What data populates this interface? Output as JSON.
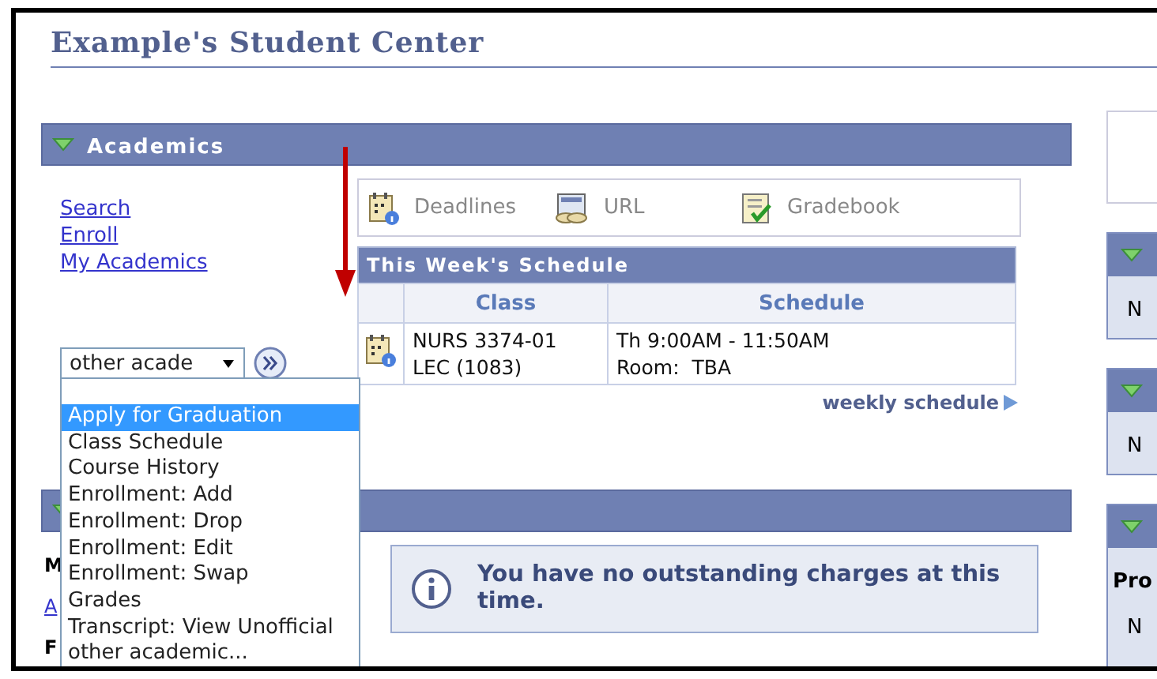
{
  "page_title": "Example's Student Center",
  "academics": {
    "title": "Academics",
    "expanded": true,
    "links": [
      "Search",
      "Enroll",
      "My Academics"
    ],
    "toolbar": [
      {
        "kind": "deadlines",
        "label": "Deadlines"
      },
      {
        "kind": "url",
        "label": "URL"
      },
      {
        "kind": "gradebook",
        "label": "Gradebook"
      }
    ],
    "schedule": {
      "title": "This Week's Schedule",
      "columns": [
        "Class",
        "Schedule"
      ],
      "rows": [
        {
          "class": [
            "NURS 3374-01",
            "LEC (1083)"
          ],
          "schedule": [
            "Th 9:00AM - 11:50AM",
            "Room:  TBA"
          ]
        }
      ],
      "link": "weekly schedule"
    },
    "select": {
      "value": "other acade",
      "options": [
        {
          "label": "Apply for Graduation",
          "selected": true
        },
        {
          "label": "Class Schedule",
          "selected": false
        },
        {
          "label": "Course History",
          "selected": false
        },
        {
          "label": "Enrollment: Add",
          "selected": false
        },
        {
          "label": "Enrollment: Drop",
          "selected": false
        },
        {
          "label": "Enrollment: Edit",
          "selected": false
        },
        {
          "label": "Enrollment: Swap",
          "selected": false
        },
        {
          "label": "Grades",
          "selected": false
        },
        {
          "label": "Transcript: View Unofficial",
          "selected": false
        },
        {
          "label": "other academic...",
          "selected": false
        }
      ]
    }
  },
  "finances": {
    "expanded": true,
    "items": [
      {
        "kind": "heading",
        "text": "M"
      },
      {
        "kind": "link",
        "text": "A"
      },
      {
        "kind": "heading",
        "text": "F"
      }
    ],
    "notice": "You have no outstanding charges at this time."
  },
  "right_column": {
    "panels": [
      {
        "lines": [
          {
            "kind": "plain",
            "text": "N"
          }
        ]
      },
      {
        "lines": [
          {
            "kind": "plain",
            "text": "N"
          }
        ]
      },
      {
        "lines": [
          {
            "kind": "heading",
            "text": "Pro"
          },
          {
            "kind": "plain",
            "text": "N"
          }
        ]
      }
    ]
  }
}
